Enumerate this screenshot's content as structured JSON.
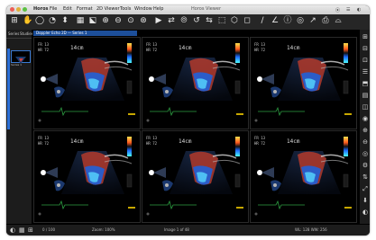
{
  "app": {
    "name": "Horos",
    "window_title": "Horos Viewer"
  },
  "menubar": {
    "items": [
      "Horos",
      "File",
      "Edit",
      "Format",
      "2D Viewer",
      "Tools",
      "Window",
      "Help"
    ],
    "right_items": [
      "⦿",
      "☰",
      "◐"
    ]
  },
  "toolbar": {
    "icons": [
      "window-level-icon",
      "move-icon",
      "zoom-icon",
      "rotate-icon",
      "scroll-icon",
      "tile-icon",
      "orientation-icon",
      "zoom-in-icon",
      "zoom-out-icon",
      "fit-icon",
      "fit-all-icon",
      "cine-icon",
      "sync-icon",
      "rgb-icon",
      "reset-icon",
      "flip-icon",
      "mpr-icon",
      "3d-icon",
      "roi-icon",
      "measure-icon",
      "angle-icon",
      "info-icon",
      "movie-icon",
      "export-icon",
      "print-icon",
      "headphones-icon"
    ],
    "glyphs": [
      "⊞",
      "✋",
      "◯",
      "◔",
      "⬍",
      "▦",
      "⬕",
      "⊕",
      "⊖",
      "⊙",
      "⊛",
      "▶",
      "⇄",
      "⦾",
      "↺",
      "⇆",
      "⬚",
      "⬡",
      "◻",
      "∕",
      "∠",
      "ⓘ",
      "◎",
      "↗",
      "⎙",
      "⌓"
    ]
  },
  "left_panel": {
    "tabs": [
      "Series",
      "Studies"
    ],
    "series_label": "Series 1"
  },
  "series_tab": {
    "label": "Doppler Echo 2D — Series 1"
  },
  "viewports": [
    {
      "id": "vp1",
      "frame": "FR 13",
      "hr": "HR 72",
      "depth": "14cm"
    },
    {
      "id": "vp2",
      "frame": "FR 13",
      "hr": "HR 72",
      "depth": "14cm"
    },
    {
      "id": "vp3",
      "frame": "FR 13",
      "hr": "HR 72",
      "depth": "14cm"
    },
    {
      "id": "vp4",
      "frame": "FR 13",
      "hr": "HR 72",
      "depth": "14cm"
    },
    {
      "id": "vp5",
      "frame": "FR 13",
      "hr": "HR 72",
      "depth": "14cm"
    },
    {
      "id": "vp6",
      "frame": "FR 13",
      "hr": "HR 72",
      "depth": "14cm"
    }
  ],
  "statusbar": {
    "left_text": "0 / 100",
    "zoom_text": "Zoom: 100%",
    "center_text": "Image 1 of 48",
    "right_text": "WL: 128 WW: 256"
  },
  "colors": {
    "accent": "#2b6fd6",
    "viewer_bg": "#000000",
    "toolbar_bg": "#262626"
  }
}
